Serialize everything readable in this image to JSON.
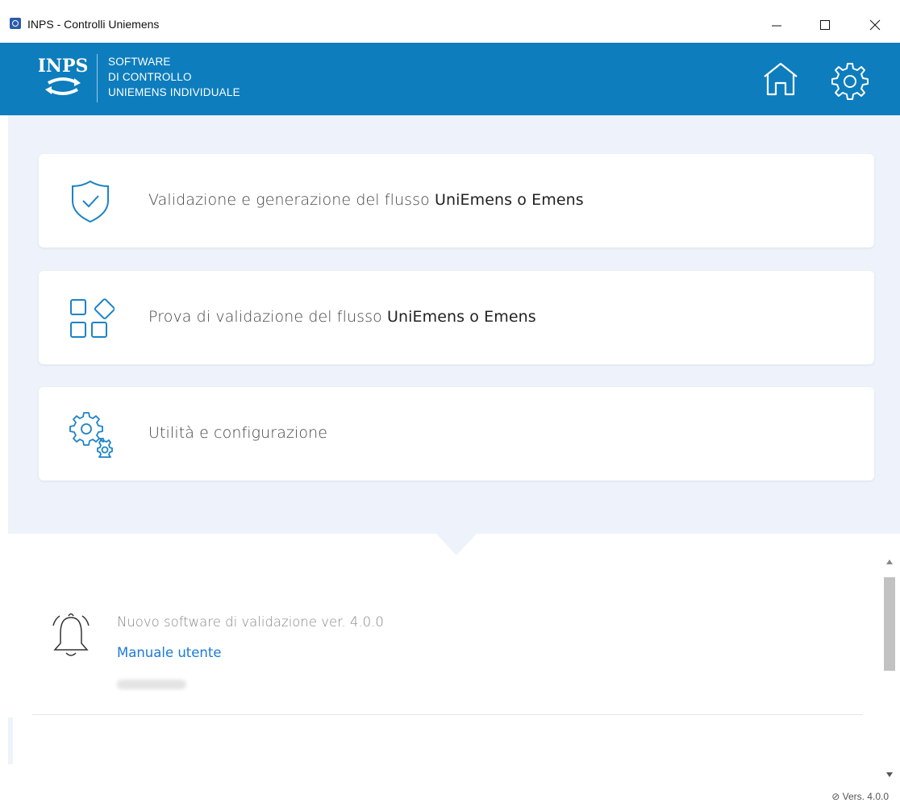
{
  "window": {
    "title": "INPS - Controlli Uniemens",
    "minimize_glyph": "—",
    "maximize_glyph": "☐",
    "close_glyph": "✕"
  },
  "header": {
    "logo_text_lines": [
      "SOFTWARE",
      "DI CONTROLLO",
      "UNIEMENS INDIVIDUALE"
    ],
    "logo_mark": "INPS",
    "home_icon": "home-icon",
    "settings_icon": "gear-icon",
    "background_color": "#0d7dbd"
  },
  "menu": {
    "items": [
      {
        "icon": "shield-check-icon",
        "text_regular": "Validazione e generazione del flusso ",
        "text_strong": "UniEmens o Emens"
      },
      {
        "icon": "apps-grid-icon",
        "text_regular": "Prova di validazione del flusso ",
        "text_strong": "UniEmens o Emens"
      },
      {
        "icon": "gears-icon",
        "text_regular": "Utilità e configurazione",
        "text_strong": ""
      }
    ]
  },
  "notifications": {
    "icon": "bell-icon",
    "title": "Nuovo software di validazione ver. 4.0.0",
    "link": "Manuale utente"
  },
  "footer": {
    "version": "Vers. 4.0.0"
  },
  "colors": {
    "accent": "#0d7dbd",
    "link": "#1c7ad6",
    "panel_bg": "#eef3fb"
  }
}
